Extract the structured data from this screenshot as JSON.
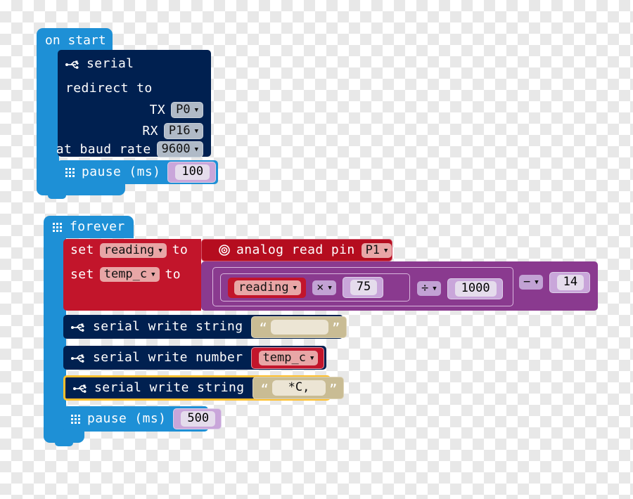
{
  "editor": {
    "name": "MakeCode micro:bit block editor",
    "colors": {
      "loops": "#1E90D6",
      "serial": "#002050",
      "variables": "#C2152B",
      "pins": "#B50D1F",
      "math": "#8A3A8F",
      "number_shadow": "#C9A6DA",
      "string_shadow": "#C9BC94",
      "selection_highlight": "#FDBF2D"
    }
  },
  "scripts": [
    {
      "id": "on-start",
      "hat_label": "on start",
      "blocks": [
        {
          "id": "serial-redirect",
          "category": "serial",
          "icon": "usb-icon",
          "text_lines": [
            "serial",
            "redirect to"
          ],
          "fields": [
            {
              "label": "TX",
              "value": "P0",
              "type": "dropdown"
            },
            {
              "label": "RX",
              "value": "P16",
              "type": "dropdown"
            },
            {
              "label": "at baud rate",
              "value": "9600",
              "type": "dropdown"
            }
          ]
        },
        {
          "id": "pause-100",
          "category": "loops",
          "icon": "led-grid-icon",
          "label": "pause (ms)",
          "value": "100"
        }
      ]
    },
    {
      "id": "forever",
      "hat_label": "forever",
      "hat_icon": "led-grid-icon",
      "blocks": [
        {
          "id": "set-reading",
          "category": "variables",
          "prefix": "set",
          "variable": "reading",
          "connector": "to",
          "value_block": {
            "id": "analog-read",
            "category": "pins",
            "icon": "pin-circle-icon",
            "label": "analog read pin",
            "pin": "P1"
          }
        },
        {
          "id": "set-temp-c",
          "category": "variables",
          "prefix": "set",
          "variable": "temp_c",
          "connector": "to",
          "value_block": {
            "id": "math-expression",
            "category": "math",
            "expression": "reading × 75 ÷ 1000 − 14",
            "operands": {
              "variable": "reading",
              "multiply_op": "×",
              "multiply_by": "75",
              "divide_op": "÷",
              "divide_by": "1000",
              "subtract_op": "−",
              "subtract_by": "14"
            }
          }
        },
        {
          "id": "serial-write-string-1",
          "category": "serial",
          "icon": "usb-icon",
          "label": "serial write string",
          "string_value": "",
          "selected": false
        },
        {
          "id": "serial-write-number",
          "category": "serial",
          "icon": "usb-icon",
          "label": "serial write number",
          "variable": "temp_c",
          "selected": false
        },
        {
          "id": "serial-write-string-2",
          "category": "serial",
          "icon": "usb-icon",
          "label": "serial write string",
          "string_value": "*C,",
          "selected": true
        },
        {
          "id": "pause-500",
          "category": "loops",
          "icon": "led-grid-icon",
          "label": "pause (ms)",
          "value": "500"
        }
      ]
    }
  ]
}
